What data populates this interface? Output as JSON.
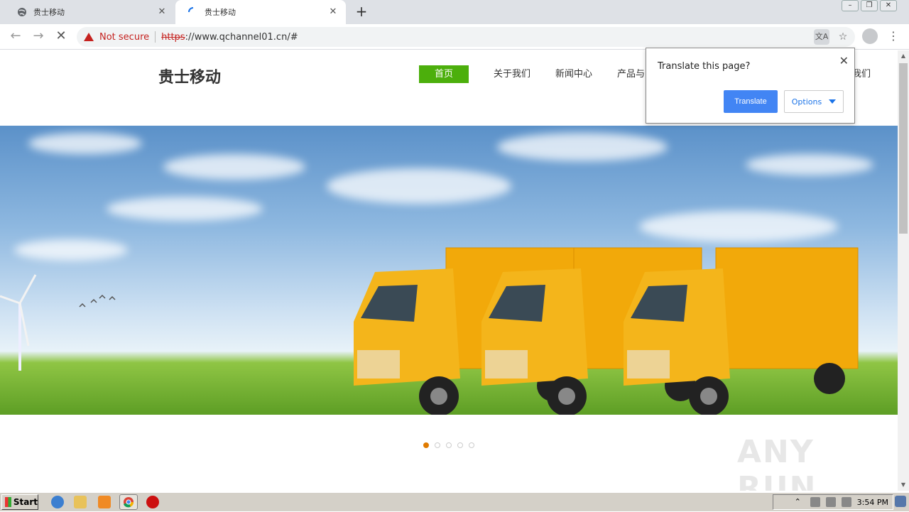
{
  "browser": {
    "tabs": [
      {
        "title": "贵士移动",
        "active": false
      },
      {
        "title": "贵士移动",
        "active": true
      }
    ],
    "new_tab": "+",
    "security_label": "Not secure",
    "url_scheme": "https",
    "url_rest": "://www.qchannel01.cn/#"
  },
  "site": {
    "logo": "贵士移动",
    "nav": [
      {
        "label": "首页",
        "active": true
      },
      {
        "label": "关于我们"
      },
      {
        "label": "新闻中心"
      },
      {
        "label": "产品与"
      }
    ],
    "nav_tail": "我们",
    "carousel": {
      "count": 5,
      "active_index": 0
    }
  },
  "translate_bubble": {
    "question": "Translate this page?",
    "translate_label": "Translate",
    "options_label": "Options"
  },
  "watermark": "ANY RUN",
  "taskbar": {
    "start_label": "Start",
    "clock": "3:54 PM"
  },
  "colors": {
    "nav_active": "#4caf0c",
    "translate_button": "#4285f4",
    "carousel_dot_active": "#e07b00",
    "truck_body": "#f2a90a"
  }
}
